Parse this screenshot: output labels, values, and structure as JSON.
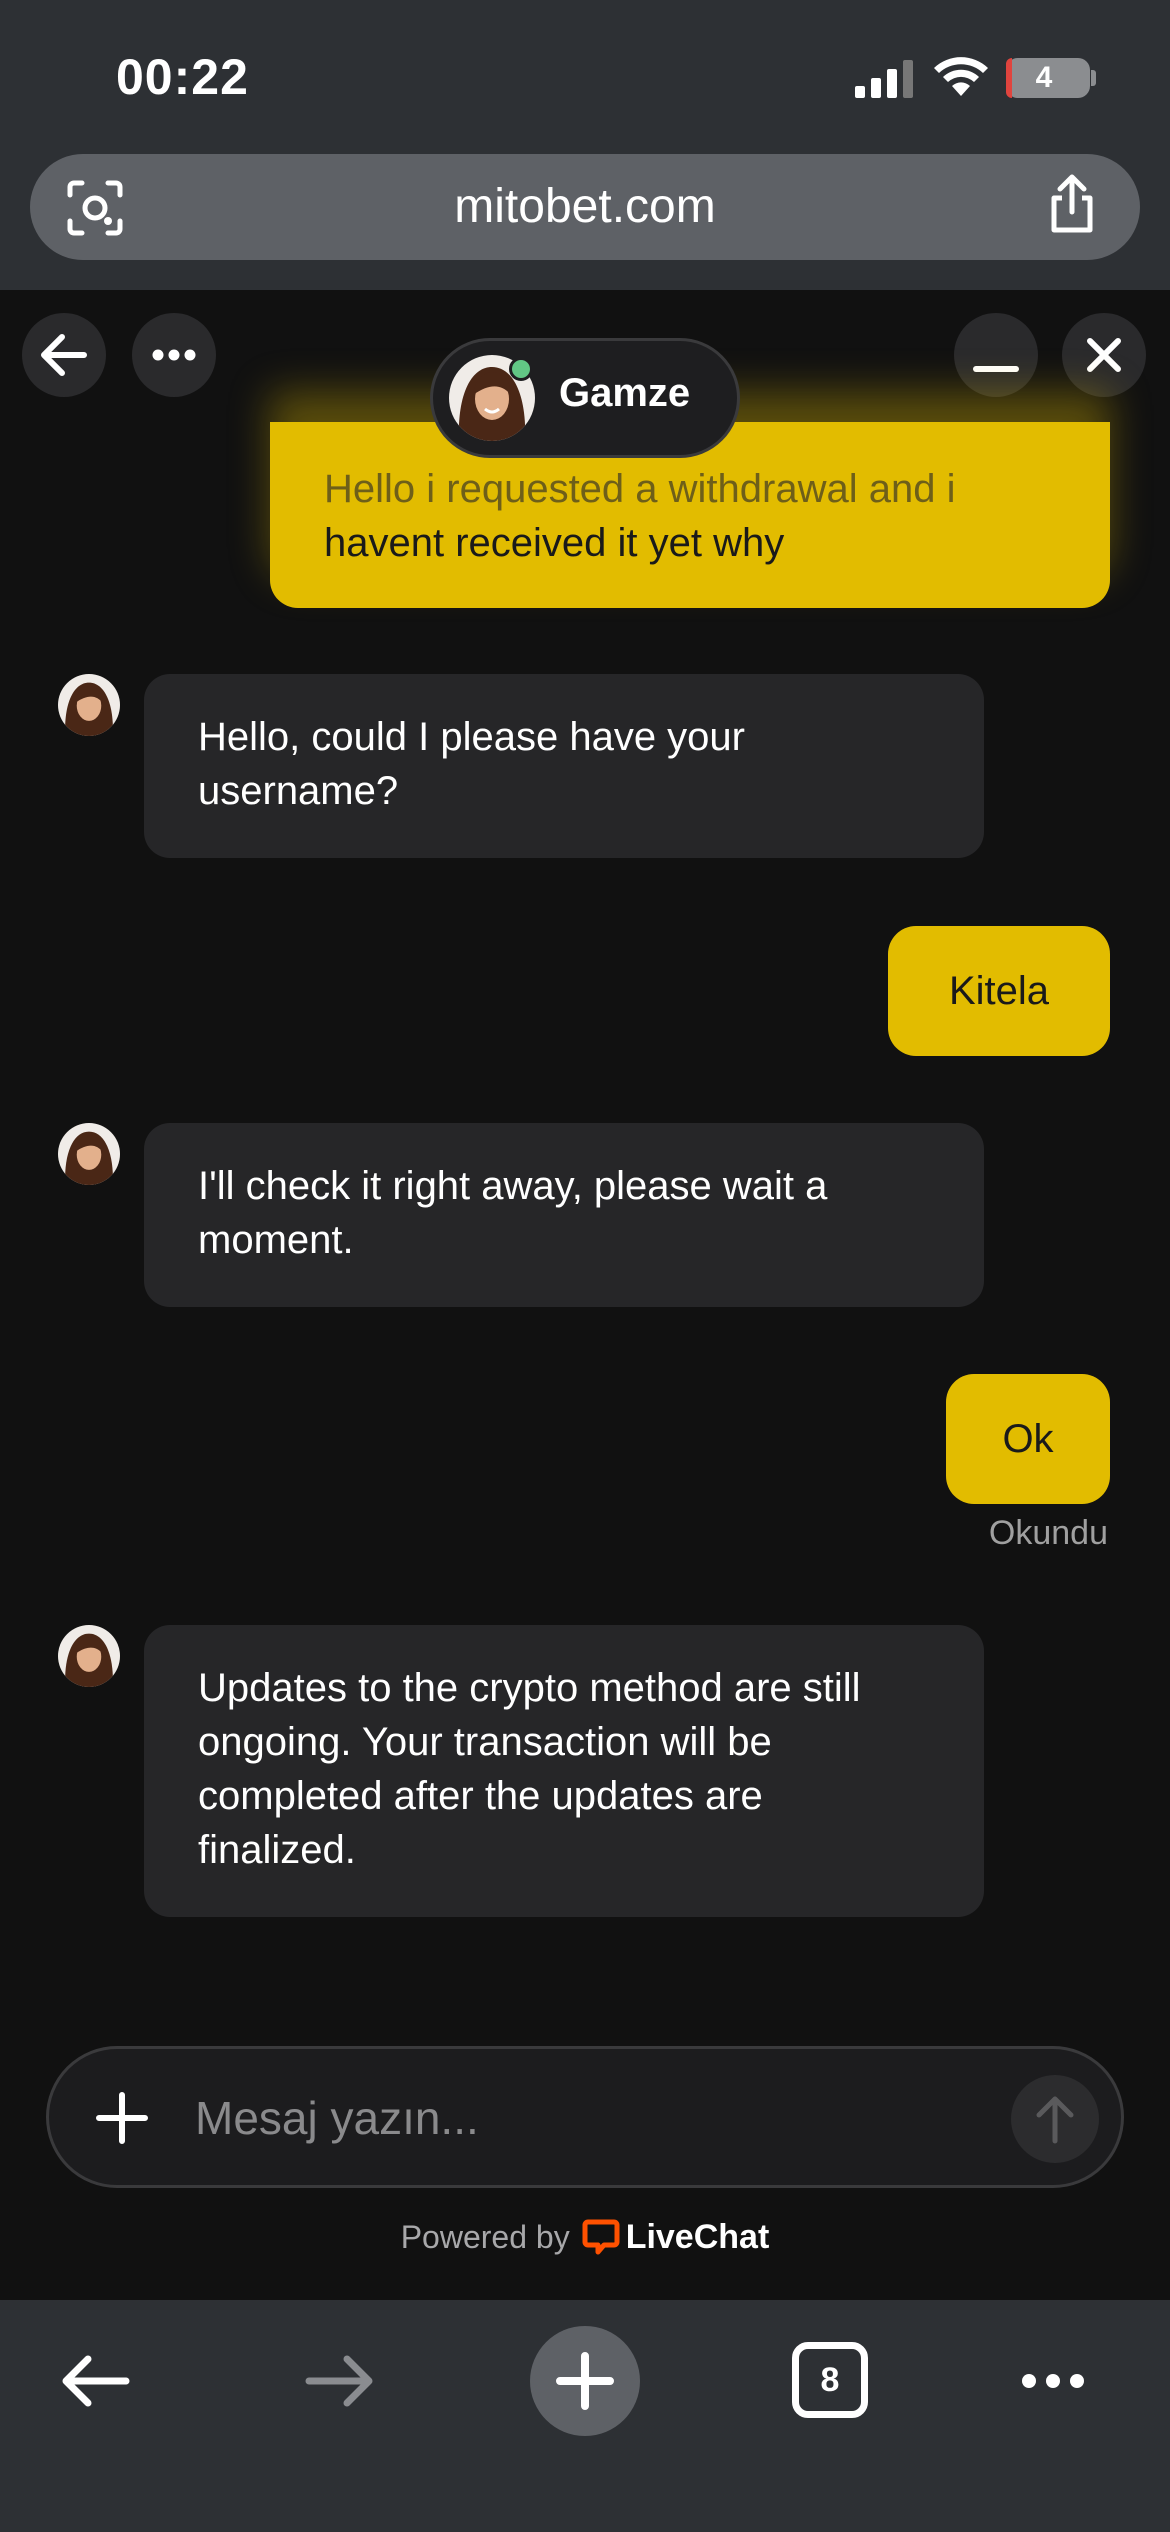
{
  "status_bar": {
    "time": "00:22",
    "battery_level": "4",
    "battery_fraction": 0.04
  },
  "browser": {
    "url": "mitobet.com",
    "tabs_count": "8"
  },
  "chat": {
    "agent_name": "Gamze",
    "messages": [
      {
        "from": "user",
        "lines": [
          "Hello i requested a withdrawal and i",
          "havent received it yet why"
        ]
      },
      {
        "from": "agent",
        "text": "Hello, could I please have your username?"
      },
      {
        "from": "user",
        "text": "Kitela"
      },
      {
        "from": "agent",
        "text": "I'll check it right away, please wait a moment."
      },
      {
        "from": "user",
        "text": "Ok"
      },
      {
        "from": "agent",
        "text": "Updates to the crypto method are still ongoing. Your transaction will be completed after the updates are finalized."
      }
    ],
    "read_status": "Okundu",
    "composer_placeholder": "Mesaj yazın...",
    "powered_by": "Powered by",
    "brand": "LiveChat"
  },
  "colors": {
    "user_bubble": "#e2bc00",
    "agent_bubble": "#262628",
    "online": "#62c785",
    "livechat": "#ff5100"
  }
}
